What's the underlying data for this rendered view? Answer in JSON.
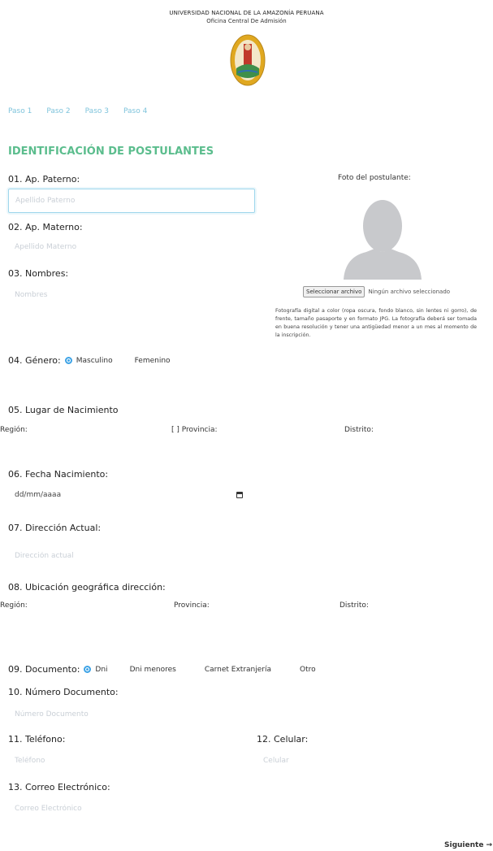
{
  "header": {
    "university": "UNIVERSIDAD NACIONAL DE LA AMAZONÍA PERUANA",
    "office": "Oficina Central De Admisión"
  },
  "steps": [
    "Paso 1",
    "Paso 2",
    "Paso 3",
    "Paso 4"
  ],
  "section_title": "IDENTIFICACIÓN DE POSTULANTES",
  "fields": {
    "ap_paterno": {
      "label": "01. Ap. Paterno:",
      "placeholder": "Apellido Paterno",
      "value": ""
    },
    "ap_materno": {
      "label": "02. Ap. Materno:",
      "placeholder": "Apellido Materno",
      "value": ""
    },
    "nombres": {
      "label": "03. Nombres:",
      "placeholder": "Nombres",
      "value": ""
    },
    "genero": {
      "label": "04. Género:",
      "options": [
        "Masculino",
        "Femenino"
      ]
    },
    "lugar_nacimiento": {
      "label": "05. Lugar de Nacimiento",
      "region": "Región:",
      "provincia": "[ ] Provincia:",
      "distrito": "Distrito:"
    },
    "fecha_nacimiento": {
      "label": "06. Fecha Nacimiento:",
      "placeholder": "dd/mm/aaaa",
      "icon": "calendar-icon"
    },
    "direccion": {
      "label": "07. Dirección Actual:",
      "placeholder": "Dirección actual",
      "value": ""
    },
    "ubicacion": {
      "label": "08. Ubicación geográfica dirección:",
      "region": "Región:",
      "provincia": "Provincia:",
      "distrito": "Distrito:"
    },
    "documento": {
      "label": "09. Documento:",
      "options": [
        "Dni",
        "Dni menores",
        "Carnet Extranjería",
        "Otro"
      ]
    },
    "numero_documento": {
      "label": "10. Número Documento:",
      "placeholder": "Número Documento",
      "value": ""
    },
    "telefono": {
      "label": "11. Teléfono:",
      "placeholder": "Teléfono",
      "value": ""
    },
    "celular": {
      "label": "12. Celular:",
      "placeholder": "Celular",
      "value": ""
    },
    "correo": {
      "label": "13. Correo Electrónico:",
      "placeholder": "Correo Electrónico",
      "value": ""
    }
  },
  "photo": {
    "label": "Foto del postulante:",
    "button": "Seleccionar archivo",
    "status": "Ningún archivo seleccionado",
    "note": "Fotografía digital a color (ropa oscura, fondo blanco, sin lentes ni gorro), de frente, tamaño pasaporte y en formato JPG. La fotografía deberá ser tomada en buena resolución y tener una antigüedad menor a un mes al momento de la inscripción."
  },
  "next_button": "Siguiente →",
  "colors": {
    "accent_green": "#5bbd8d",
    "step_blue": "#7fc4dc",
    "radio_blue": "#3da3e6"
  }
}
